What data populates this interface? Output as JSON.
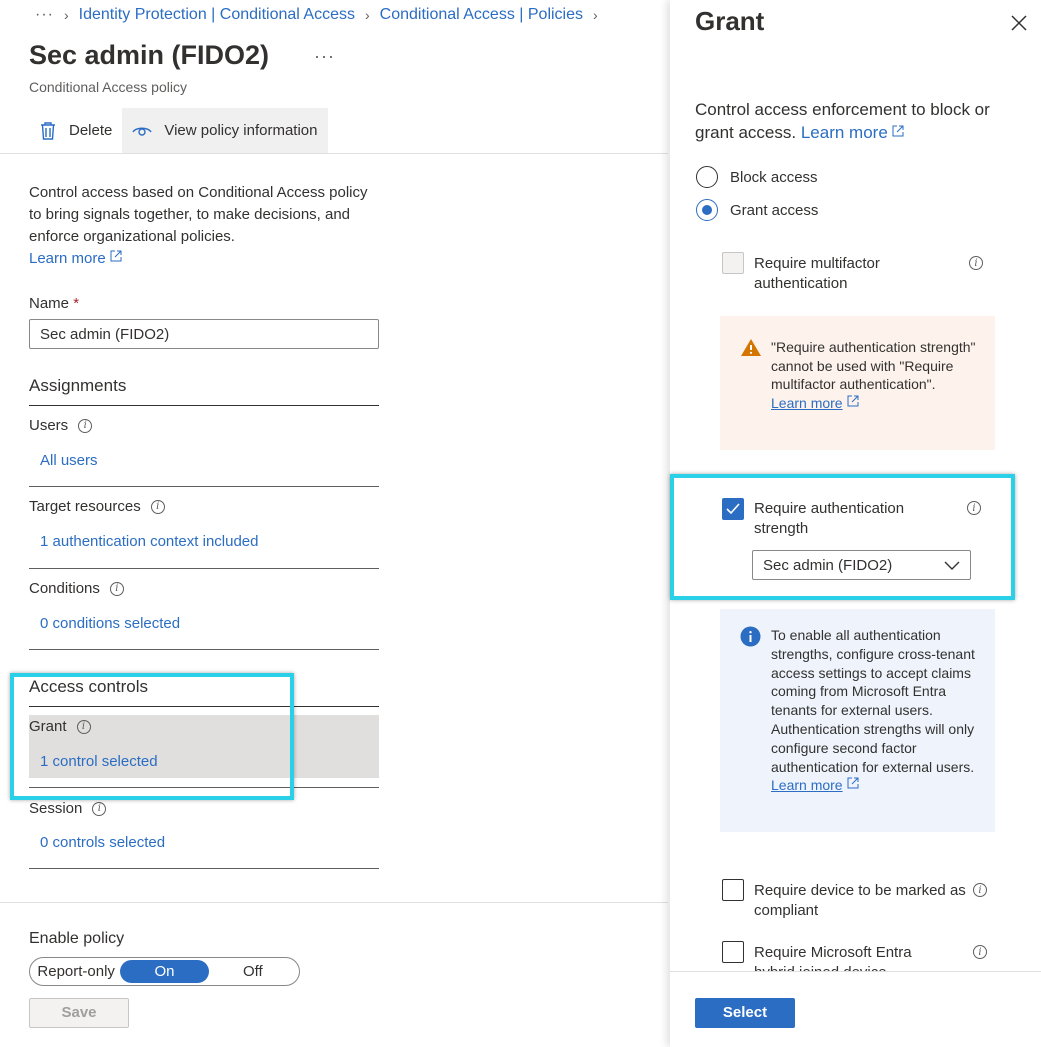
{
  "breadcrumb": {
    "ellipsis": "···",
    "items": [
      "Identity Protection | Conditional Access",
      "Conditional Access | Policies"
    ]
  },
  "header": {
    "title": "Sec admin (FIDO2)",
    "more": "···",
    "subtitle": "Conditional Access policy"
  },
  "toolbar": {
    "delete_label": "Delete",
    "view_info_label": "View policy information"
  },
  "intro": {
    "text": "Control access based on Conditional Access policy to bring signals together, to make decisions, and enforce organizational policies.",
    "learn_more": "Learn more"
  },
  "name_field": {
    "label": "Name",
    "required_mark": "*",
    "value": "Sec admin (FIDO2)"
  },
  "assignments": {
    "heading": "Assignments",
    "users": {
      "label": "Users",
      "value": "All users"
    },
    "target_resources": {
      "label": "Target resources",
      "value": "1 authentication context included"
    },
    "conditions": {
      "label": "Conditions",
      "value": "0 conditions selected"
    }
  },
  "access_controls": {
    "heading": "Access controls",
    "grant": {
      "label": "Grant",
      "value": "1 control selected"
    },
    "session": {
      "label": "Session",
      "value": "0 controls selected"
    }
  },
  "enable_policy": {
    "label": "Enable policy",
    "options": [
      "Report-only",
      "On",
      "Off"
    ],
    "selected": "On"
  },
  "save_label": "Save",
  "panel": {
    "title": "Grant",
    "description": "Control access enforcement to block or grant access.",
    "learn_more": "Learn more",
    "radio_block": "Block access",
    "radio_grant": "Grant access",
    "require_mfa": "Require multifactor authentication",
    "warning": {
      "text": "\"Require authentication strength\" cannot be used with \"Require multifactor authentication\".",
      "learn_more": "Learn more"
    },
    "require_auth_strength": "Require authentication strength",
    "auth_strength_value": "Sec admin (FIDO2)",
    "info": {
      "text": "To enable all authentication strengths, configure cross-tenant access settings to accept claims coming from Microsoft Entra tenants for external users. Authentication strengths will only configure second factor authentication for external users.",
      "learn_more": "Learn more"
    },
    "require_compliant": "Require device to be marked as compliant",
    "require_hybrid": "Require Microsoft Entra hybrid joined device",
    "select_label": "Select"
  },
  "colors": {
    "accent": "#2b6dc3",
    "highlight": "#2ad0e8",
    "warning_bg": "#fdf3ec",
    "warning_icon": "#d47500",
    "info_bg": "#eff4fc"
  }
}
